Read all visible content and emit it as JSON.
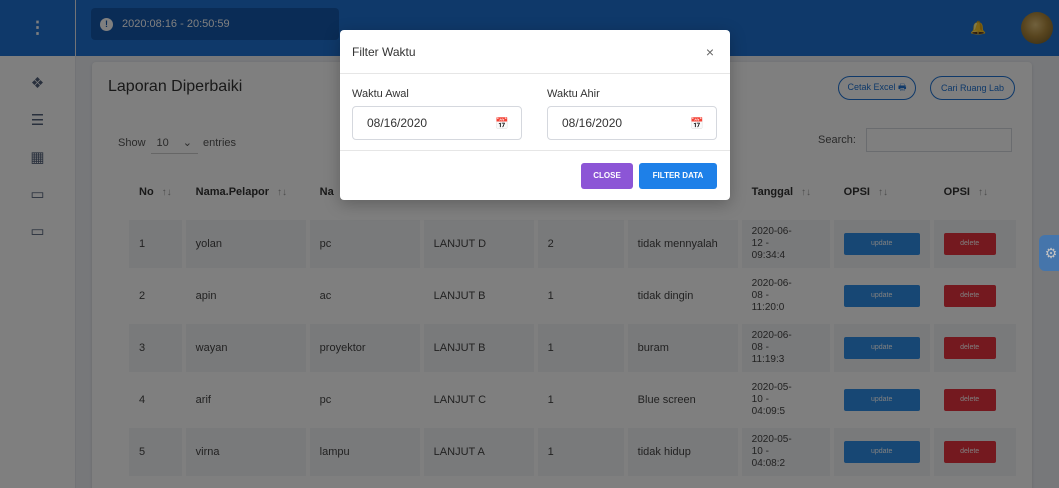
{
  "sidebar": {
    "menu_icon": "⋮",
    "icons": [
      {
        "name": "layers-icon",
        "glyph": "❖"
      },
      {
        "name": "list-icon",
        "glyph": "☰"
      },
      {
        "name": "table-icon",
        "glyph": "▦"
      },
      {
        "name": "monitor-icon",
        "glyph": "▭"
      },
      {
        "name": "desktop-icon",
        "glyph": "▭"
      }
    ]
  },
  "topbar": {
    "datetime": "2020:08:16 - 20:50:59",
    "clock_icon": "!",
    "bell_icon": "🔔"
  },
  "page": {
    "title": "Laporan Diperbaiki",
    "export_button": "Cetak Excel 🖶",
    "lab_button": "Cari Ruang Lab",
    "show_label": "Show",
    "entries_value": "10",
    "entries_chevron": "⌄",
    "entries_label": "entries",
    "search_label": "Search:"
  },
  "table": {
    "sort_glyph": "↑↓",
    "headers": [
      "No",
      "Nama.Pelapor",
      "Na",
      "",
      "",
      "",
      "Tanggal",
      "OPSI",
      "OPSI"
    ],
    "rows": [
      {
        "no": "1",
        "pelapor": "yolan",
        "barang": "pc",
        "ruang": "LANJUT D",
        "jumlah": "2",
        "keterangan": "tidak mennyalah",
        "tanggal": [
          "2020-06-",
          "12 -",
          "09:34:4"
        ],
        "update": "update",
        "delete": "delete"
      },
      {
        "no": "2",
        "pelapor": "apin",
        "barang": "ac",
        "ruang": "LANJUT B",
        "jumlah": "1",
        "keterangan": "tidak dingin",
        "tanggal": [
          "2020-06-",
          "08 -",
          "11:20:0"
        ],
        "update": "update",
        "delete": "delete"
      },
      {
        "no": "3",
        "pelapor": "wayan",
        "barang": "proyektor",
        "ruang": "LANJUT B",
        "jumlah": "1",
        "keterangan": "buram",
        "tanggal": [
          "2020-06-",
          "08 -",
          "11:19:3"
        ],
        "update": "update",
        "delete": "delete"
      },
      {
        "no": "4",
        "pelapor": "arif",
        "barang": "pc",
        "ruang": "LANJUT C",
        "jumlah": "1",
        "keterangan": "Blue screen",
        "tanggal": [
          "2020-05-",
          "10 -",
          "04:09:5"
        ],
        "update": "update",
        "delete": "delete"
      },
      {
        "no": "5",
        "pelapor": "virna",
        "barang": "lampu",
        "ruang": "LANJUT A",
        "jumlah": "1",
        "keterangan": "tidak hidup",
        "tanggal": [
          "2020-05-",
          "10 -",
          "04:08:2"
        ],
        "update": "update",
        "delete": "delete"
      }
    ]
  },
  "modal": {
    "title": "Filter Waktu",
    "close_glyph": "×",
    "start_label": "Waktu Awal",
    "start_value": "08/16/2020",
    "end_label": "Waktu Ahir",
    "end_value": "08/16/2020",
    "calendar_glyph": "📅",
    "close_button": "CLOSE",
    "filter_button": "FILTER DATA"
  },
  "colors": {
    "primary": "#1e73d4",
    "close_purple": "#8c55d6",
    "update_blue": "#2f8fe8",
    "delete_red": "#e8323f"
  }
}
